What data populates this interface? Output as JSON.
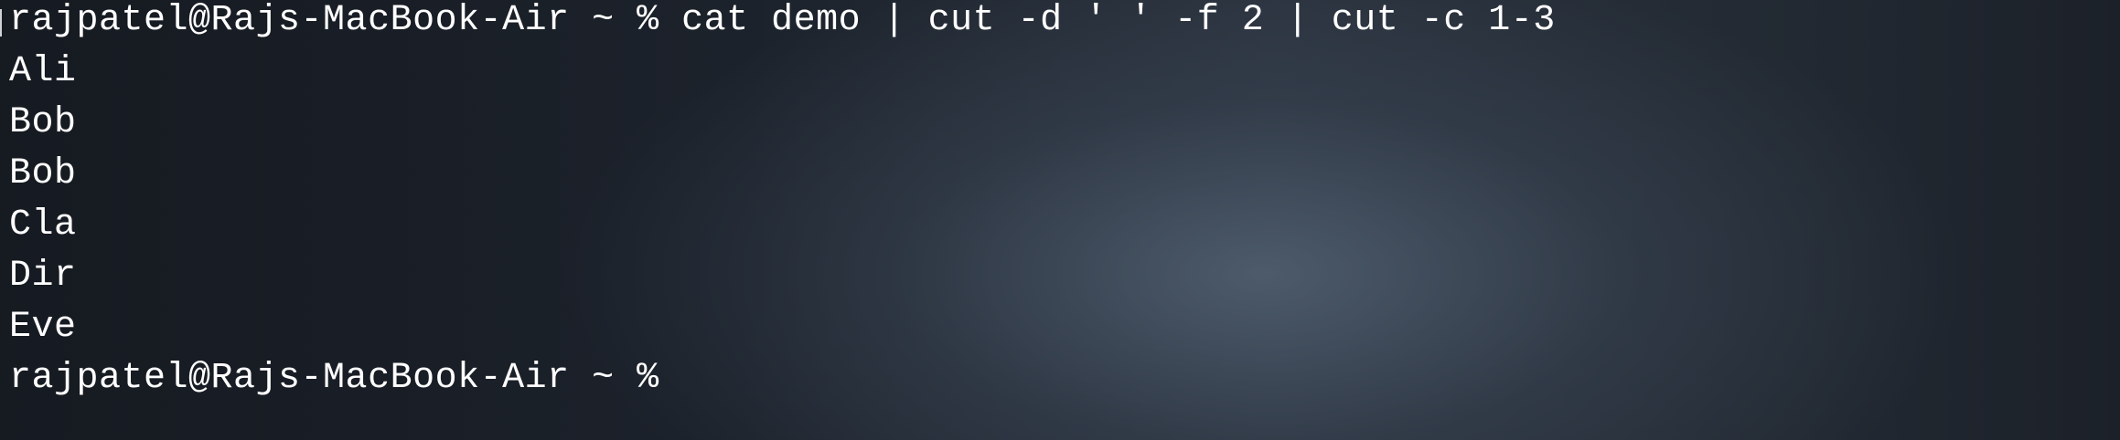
{
  "terminal": {
    "lines": [
      "rajpatel@Rajs-MacBook-Air ~ % cat demo | cut -d ' ' -f 2 | cut -c 1-3",
      "Ali",
      "Bob",
      "Bob",
      "Cla",
      "Dir",
      "Eve",
      "rajpatel@Rajs-MacBook-Air ~ % "
    ]
  }
}
